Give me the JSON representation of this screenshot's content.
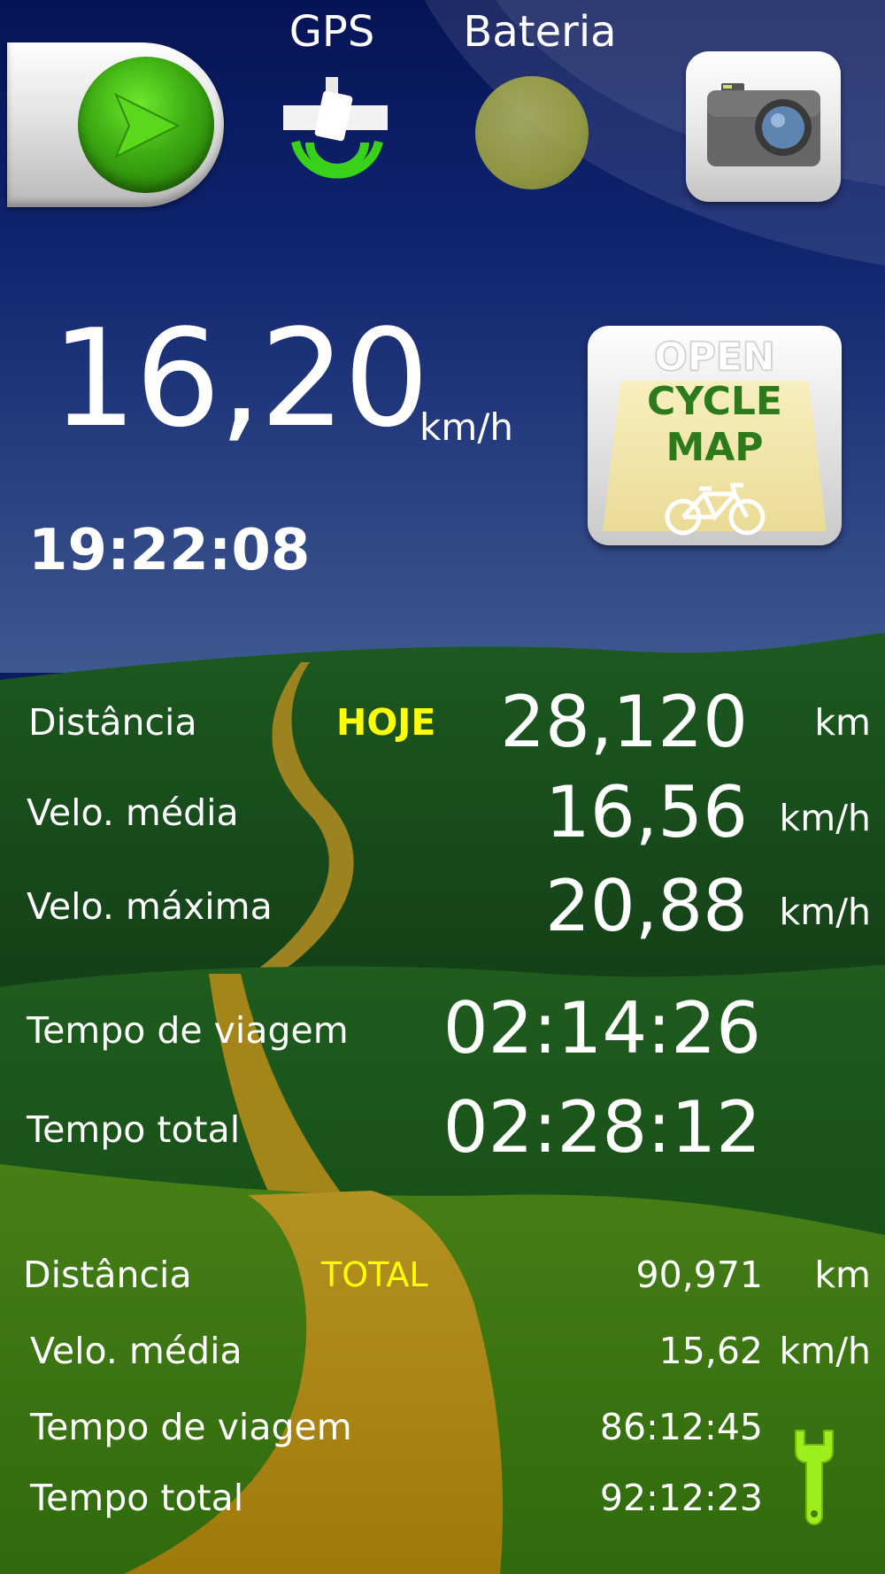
{
  "header": {
    "gps_label": "GPS",
    "battery_label": "Bateria"
  },
  "current": {
    "speed": "16,20",
    "speed_unit": "km/h",
    "clock": "19:22:08"
  },
  "map_button": {
    "line1": "OPEN",
    "line2": "CYCLE",
    "line3": "MAP"
  },
  "today": {
    "tag": "HOJE",
    "distance_label": "Distância",
    "distance_value": "28,120",
    "distance_unit": "km",
    "avg_label": "Velo. média",
    "avg_value": "16,56",
    "avg_unit": "km/h",
    "max_label": "Velo. máxima",
    "max_value": "20,88",
    "max_unit": "km/h",
    "trip_time_label": "Tempo de viagem",
    "trip_time_value": "02:14:26",
    "total_time_label": "Tempo total",
    "total_time_value": "02:28:12"
  },
  "total": {
    "tag": "TOTAL",
    "distance_label": "Distância",
    "distance_value": "90,971",
    "distance_unit": "km",
    "avg_label": "Velo. média",
    "avg_value": "15,62",
    "avg_unit": "km/h",
    "trip_time_label": "Tempo de viagem",
    "trip_time_value": "86:12:45",
    "total_time_label": "Tempo total",
    "total_time_value": "92:12:23"
  },
  "icons": {
    "play": "play-icon",
    "gps": "satellite-icon",
    "battery": "battery-icon",
    "camera": "camera-icon",
    "bike": "bicycle-icon",
    "settings": "wrench-icon"
  },
  "colors": {
    "sky_top": "#08175e",
    "sky_bottom": "#3a558f",
    "grass_dark": "#17461a",
    "grass_light": "#3f7a12",
    "path": "#a9861c",
    "accent_yellow": "#ffff00",
    "play_green": "#3cab12"
  }
}
